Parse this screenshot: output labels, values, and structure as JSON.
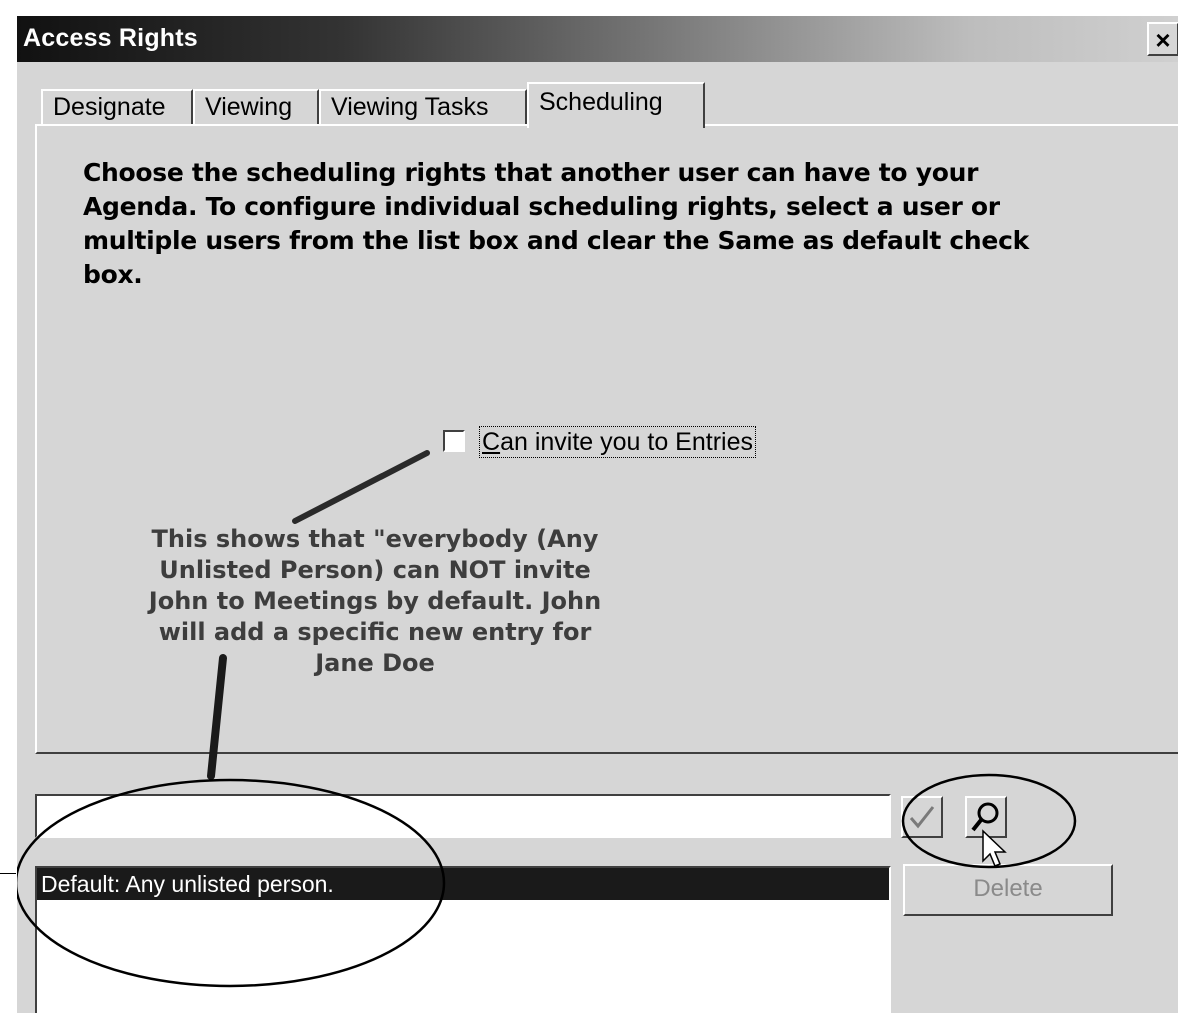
{
  "window": {
    "title": "Access Rights",
    "close_glyph": "×"
  },
  "tabs": [
    {
      "label": "Designate",
      "active": false
    },
    {
      "label": "Viewing",
      "active": false
    },
    {
      "label": "Viewing Tasks",
      "active": false
    },
    {
      "label": "Scheduling",
      "active": true
    }
  ],
  "panel": {
    "description": "Choose the scheduling rights that another user can have to your Agenda. To configure individual scheduling rights, select a user or multiple users from the list box and clear the Same as default check box.",
    "checkbox": {
      "label": "Can invite you to Entries",
      "checked": false,
      "accesskey": "C"
    }
  },
  "annotation": {
    "lines": [
      "This shows that \"everybody (Any",
      "Unlisted Person) can NOT invite",
      "John to Meetings by default.  John",
      "will add a specific new entry for",
      "Jane Doe"
    ]
  },
  "user_search": {
    "value": "",
    "placeholder": ""
  },
  "buttons": {
    "accept_icon": "checkmark-icon",
    "search_icon": "magnifier-icon",
    "delete_label": "Delete"
  },
  "user_list": {
    "items": [
      {
        "label": "Default: Any unlisted person.",
        "selected": true
      }
    ]
  },
  "colors": {
    "dialog_bg": "#d6d6d6",
    "selection_bg": "#1a1a1a",
    "annotation_text": "#3d3d3d"
  }
}
